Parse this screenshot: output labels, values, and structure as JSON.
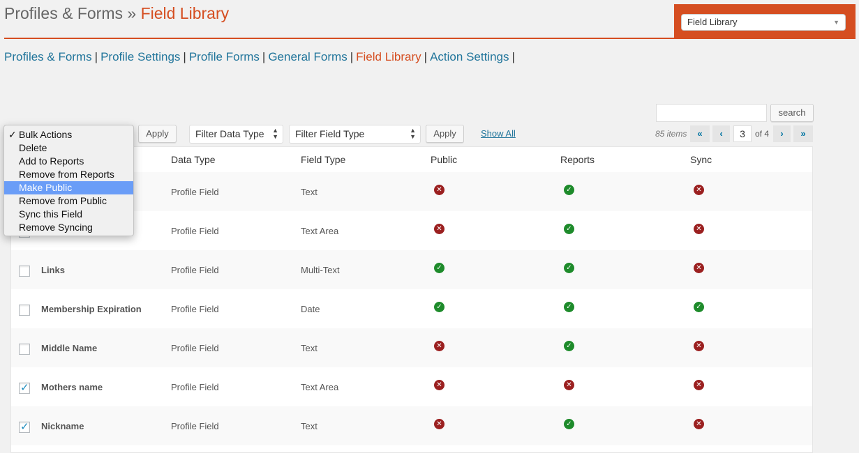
{
  "title": {
    "main": "Profiles & Forms",
    "separator": "»",
    "sub": "Field Library"
  },
  "page_select": {
    "value": "Field Library"
  },
  "subnav": [
    {
      "label": "Profiles & Forms",
      "current": false
    },
    {
      "label": "Profile Settings",
      "current": false
    },
    {
      "label": "Profile Forms",
      "current": false
    },
    {
      "label": "General Forms",
      "current": false
    },
    {
      "label": "Field Library",
      "current": true
    },
    {
      "label": "Action Settings",
      "current": false
    }
  ],
  "subnav_sep": "|",
  "search": {
    "button": "search",
    "value": ""
  },
  "bulk": {
    "apply": "Apply",
    "options": [
      "Bulk Actions",
      "Delete",
      "Add to Reports",
      "Remove from Reports",
      "Make Public",
      "Remove from Public",
      "Sync this Field",
      "Remove Syncing"
    ],
    "checkmark": "✓"
  },
  "filters": {
    "data_type": "Filter Data Type",
    "field_type": "Filter Field Type",
    "apply": "Apply",
    "show_all": "Show All"
  },
  "pagination": {
    "items": "85 items",
    "first": "«",
    "prev": "‹",
    "current": "3",
    "of": "of 4",
    "next": "›",
    "last": "»"
  },
  "table": {
    "headers": {
      "data_type": "Data Type",
      "field_type": "Field Type",
      "public": "Public",
      "reports": "Reports",
      "sync": "Sync"
    },
    "rows": [
      {
        "name": "",
        "data_type": "Profile Field",
        "field_type": "Text",
        "public": false,
        "reports": true,
        "sync": false,
        "checked": false
      },
      {
        "name": "",
        "data_type": "Profile Field",
        "field_type": "Text Area",
        "public": false,
        "reports": true,
        "sync": false,
        "checked": false
      },
      {
        "name": "Links",
        "data_type": "Profile Field",
        "field_type": "Multi-Text",
        "public": true,
        "reports": true,
        "sync": false,
        "checked": false
      },
      {
        "name": "Membership Expiration",
        "data_type": "Profile Field",
        "field_type": "Date",
        "public": true,
        "reports": true,
        "sync": true,
        "checked": false
      },
      {
        "name": "Middle Name",
        "data_type": "Profile Field",
        "field_type": "Text",
        "public": false,
        "reports": true,
        "sync": false,
        "checked": false
      },
      {
        "name": "Mothers name",
        "data_type": "Profile Field",
        "field_type": "Text Area",
        "public": false,
        "reports": false,
        "sync": false,
        "checked": true
      },
      {
        "name": "Nickname",
        "data_type": "Profile Field",
        "field_type": "Text",
        "public": false,
        "reports": true,
        "sync": false,
        "checked": true
      }
    ]
  },
  "icons": {
    "yes": "check-circle-icon",
    "no": "x-circle-icon"
  },
  "colors": {
    "accent": "#d54e21",
    "link": "#21759b",
    "yes": "#1e8b2b",
    "no": "#9b2020",
    "highlight": "#6a9df7"
  }
}
